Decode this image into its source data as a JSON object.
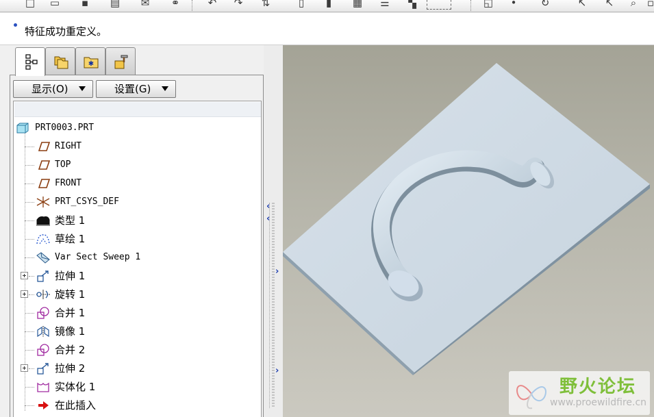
{
  "message": {
    "text": "特征成功重定义。"
  },
  "nav_tabs": [
    {
      "icon": "model-tree-icon",
      "active": true
    },
    {
      "icon": "folder-browser-icon",
      "active": false
    },
    {
      "icon": "favorites-icon",
      "active": false
    },
    {
      "icon": "connections-icon",
      "active": false
    }
  ],
  "tree_controls": {
    "show_label": "显示(O)",
    "settings_label": "设置(G)"
  },
  "model_tree": {
    "root": {
      "label": "PRT0003.PRT",
      "icon": "part-icon"
    },
    "items": [
      {
        "label": "RIGHT",
        "icon": "datum-plane-icon",
        "mono": true,
        "expandable": false
      },
      {
        "label": "TOP",
        "icon": "datum-plane-icon",
        "mono": true,
        "expandable": false
      },
      {
        "label": "FRONT",
        "icon": "datum-plane-icon",
        "mono": true,
        "expandable": false
      },
      {
        "label": "PRT_CSYS_DEF",
        "icon": "coordinate-system-icon",
        "mono": true,
        "expandable": false
      },
      {
        "label": "类型 1",
        "icon": "type-feature-icon",
        "mono": false,
        "expandable": false
      },
      {
        "label": "草绘 1",
        "icon": "sketch-icon",
        "mono": false,
        "expandable": false
      },
      {
        "label": "Var Sect Sweep 1",
        "icon": "var-sect-sweep-icon",
        "mono": true,
        "expandable": false
      },
      {
        "label": "拉伸 1",
        "icon": "extrude-icon",
        "mono": false,
        "expandable": true
      },
      {
        "label": "旋转 1",
        "icon": "revolve-icon",
        "mono": false,
        "expandable": true
      },
      {
        "label": "合并 1",
        "icon": "merge-icon",
        "mono": false,
        "expandable": false
      },
      {
        "label": "镜像 1",
        "icon": "mirror-icon",
        "mono": false,
        "expandable": false
      },
      {
        "label": "合并 2",
        "icon": "merge-icon",
        "mono": false,
        "expandable": false
      },
      {
        "label": "拉伸 2",
        "icon": "extrude-icon",
        "mono": false,
        "expandable": true
      },
      {
        "label": "实体化 1",
        "icon": "solidify-icon",
        "mono": false,
        "expandable": false
      },
      {
        "label": "在此插入",
        "icon": "insert-here-arrow-icon",
        "mono": false,
        "expandable": false
      }
    ]
  },
  "watermark": {
    "title": "野火论坛",
    "url": "www.proewildfire.cn"
  },
  "colors": {
    "plate_top": "#cdd9e3",
    "handle": "#c9d6e1",
    "viewport_bg": "#b7b6ab",
    "tree_icon_brown": "#8a3d10",
    "insert_arrow": "#d81010",
    "watermark_green": "#7fbf3a"
  }
}
